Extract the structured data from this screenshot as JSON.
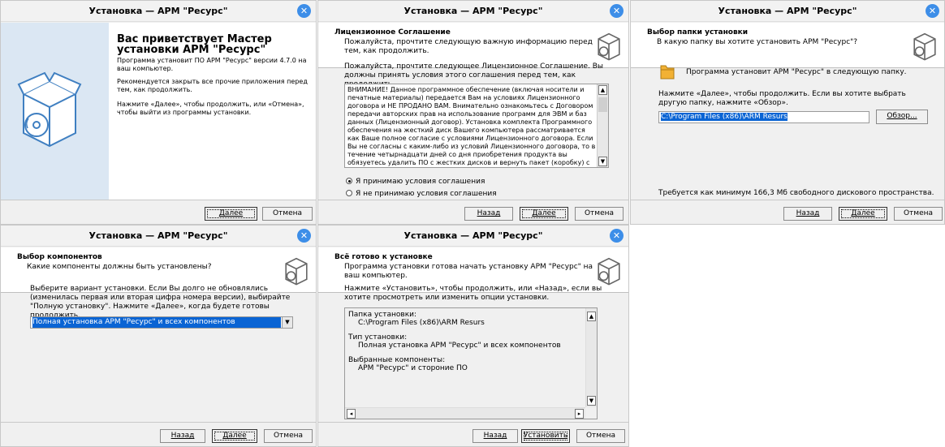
{
  "colors": {
    "close_button": "#3d8ee8",
    "selection": "#0a64d4",
    "welcome_panel": "#dbe7f3"
  },
  "icons": {
    "close": "close-icon",
    "setup_box": "setup-box-icon",
    "folder": "folder-icon",
    "dropdown": "chevron-down-icon"
  },
  "common": {
    "window_title": "Установка — АРМ \"Ресурс\"",
    "close": "✕",
    "back": "Назад",
    "next": "Далее",
    "cancel": "Отмена"
  },
  "welcome": {
    "title": "Вас приветствует Мастер установки АРМ \"Ресурс\"",
    "p1": "Программа установит ПО АРМ \"Ресурс\" версии 4.7.0 на ваш компьютер.",
    "p2": "Рекомендуется закрыть все прочие приложения перед тем, как продолжить.",
    "p3": "Нажмите «Далее», чтобы продолжить, или «Отмена», чтобы выйти из программы установки."
  },
  "license": {
    "header_title": "Лицензионное Соглашение",
    "header_sub": "Пожалуйста, прочтите следующую важную информацию перед тем, как продолжить.",
    "intro": "Пожалуйста, прочтите следующее Лицензионное Соглашение. Вы должны принять условия этого соглашения перед тем, как продолжить.",
    "text": "ВНИМАНИЕ! Данное программное обеспечение (включая носители и печатные материалы) передается Вам на условиях Лицензионного договора и НЕ ПРОДАНО ВАМ. Внимательно ознакомьтесь с Договором передачи авторских прав на использование программ для ЭВМ и баз данных (Лицензионный договор). Установка комплекта Программного обеспечения на жесткий диск Вашего компьютера рассматривается как Ваше полное согласие с условиями Лицензионного договора. Если Вы не согласны с каким-либо из условий Лицензионного договора, то в течение четырнадцати дней со дня приобретения продукта вы обязуетесь удалить ПО с жестких дисков и вернуть пакет (коробку) с дисками, электронный ключ и полный комплект документации и упаковки в",
    "accept": "Я принимаю условия соглашения",
    "decline": "Я не принимаю условия соглашения"
  },
  "folder": {
    "header_title": "Выбор папки установки",
    "header_sub": "В какую папку вы хотите установить АРМ \"Ресурс\"?",
    "line1": "Программа установит АРМ \"Ресурс\" в следующую папку.",
    "line2": "Нажмите «Далее», чтобы продолжить. Если вы хотите выбрать другую папку, нажмите «Обзор».",
    "path": "C:\\Program Files (x86)\\ARM Resurs",
    "browse": "Обзор...",
    "space": "Требуется как минимум 166,3 Мб свободного дискового пространства."
  },
  "components": {
    "header_title": "Выбор компонентов",
    "header_sub": "Какие компоненты должны быть установлены?",
    "text": "Выберите вариант установки. Если Вы долго не обновлялись (изменилась первая или вторая цифра номера версии), выбирайте \"Полную установку\". Нажмите «Далее», когда будете готовы продолжить.",
    "selected": "Полная установка АРМ \"Ресурс\" и всех компонентов"
  },
  "ready": {
    "header_title": "Всё готово к установке",
    "header_sub": "Программа установки готова начать установку АРМ \"Ресурс\" на ваш компьютер.",
    "text": "Нажмите «Установить», чтобы продолжить, или «Назад», если вы хотите просмотреть или изменить опции установки.",
    "memo": [
      {
        "label": "Папка установки:",
        "value": "C:\\Program Files (x86)\\ARM Resurs"
      },
      {
        "label": "Тип установки:",
        "value": "Полная установка АРМ \"Ресурс\" и всех компонентов"
      },
      {
        "label": "Выбранные компоненты:",
        "value": "АРМ \"Ресурс\" и стороние ПО"
      }
    ],
    "install": "Установить"
  }
}
